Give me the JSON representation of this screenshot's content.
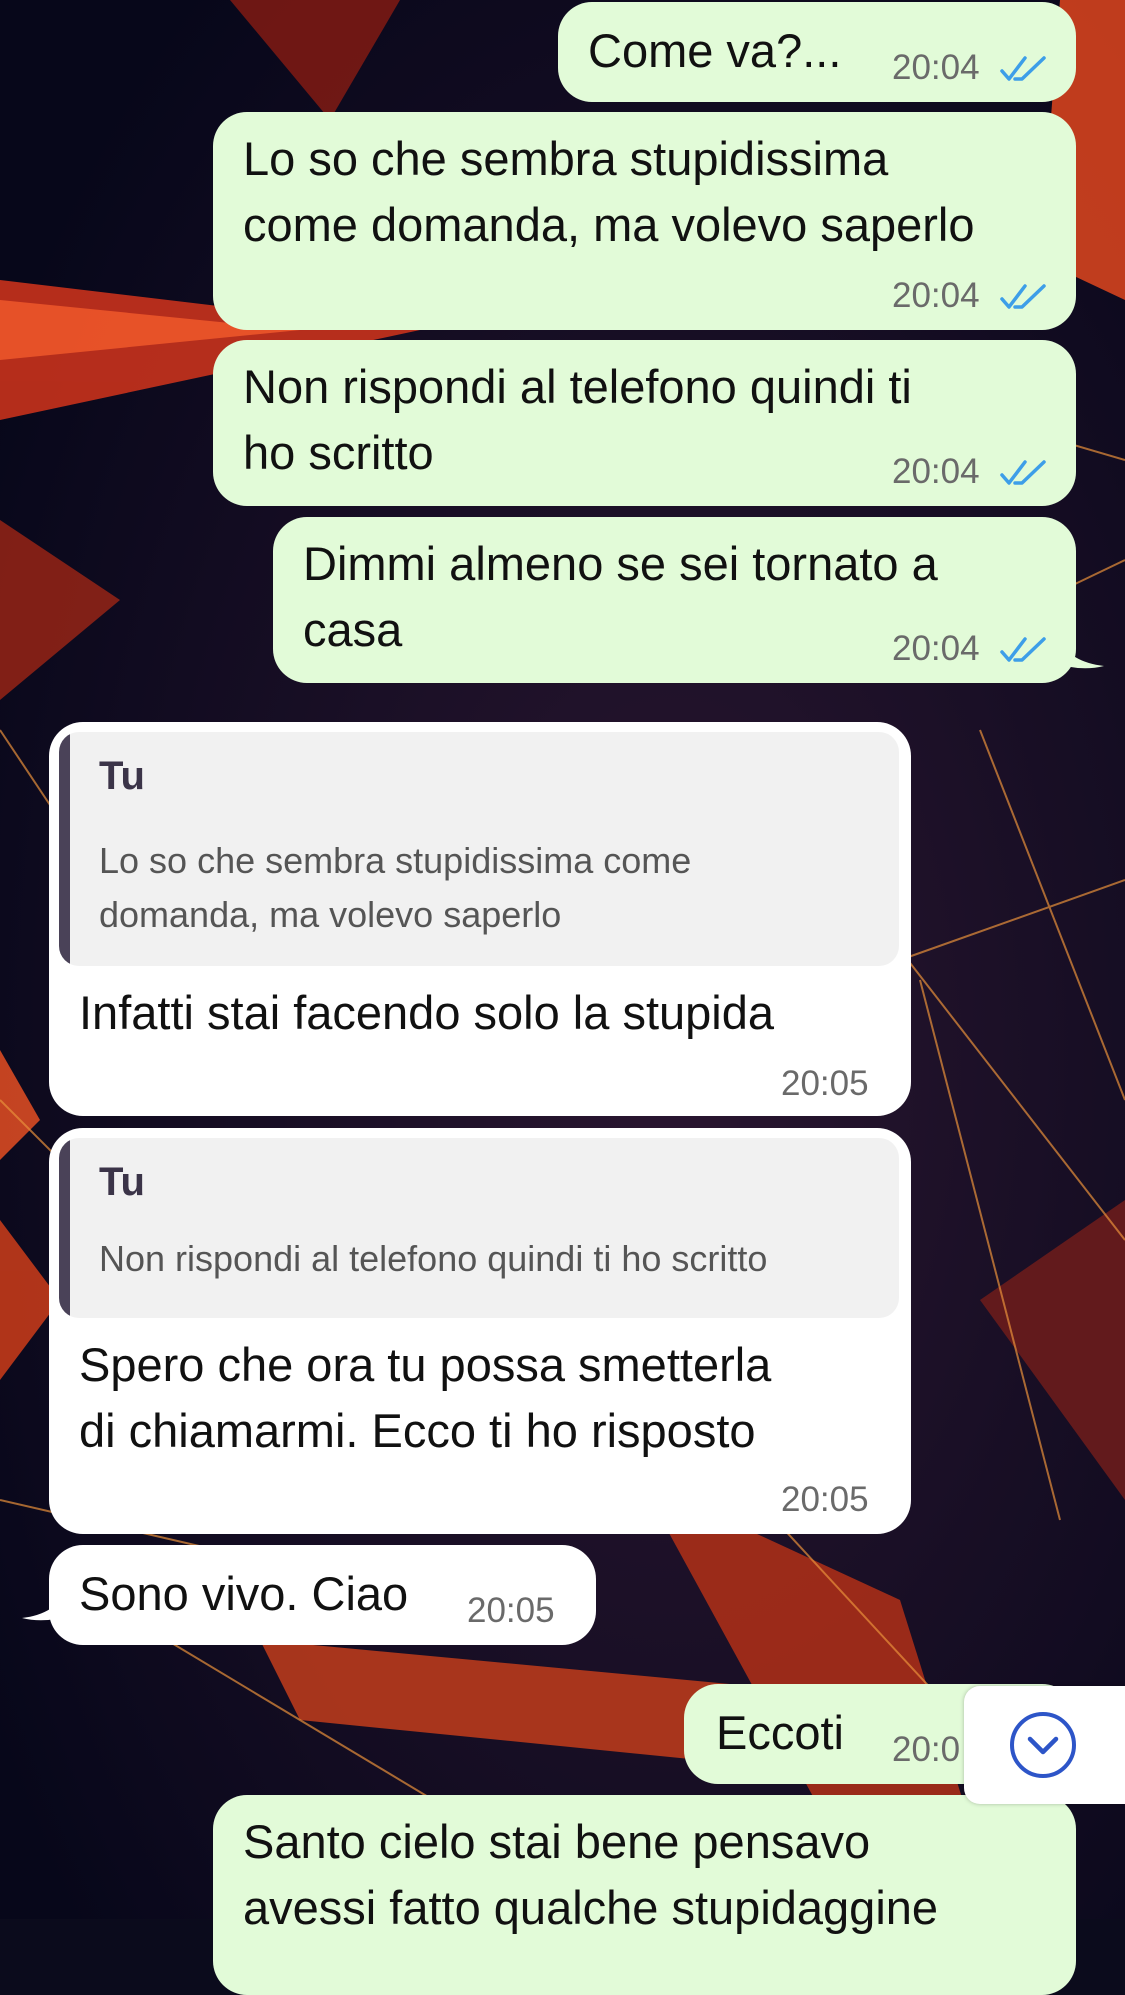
{
  "messages": {
    "m1": {
      "text": "Come va?...",
      "time": "20:04",
      "status": "read"
    },
    "m2": {
      "text": "Lo so che sembra stupidissima\ncome domanda, ma volevo saperlo",
      "time": "20:04",
      "status": "read"
    },
    "m3": {
      "text": "Non rispondi al telefono quindi ti\nho scritto",
      "time": "20:04",
      "status": "read"
    },
    "m4": {
      "text": "Dimmi almeno se sei tornato a\ncasa",
      "time": "20:04",
      "status": "read"
    },
    "m5": {
      "quote": {
        "author": "Tu",
        "text": "Lo so che sembra stupidissima come\ndomanda, ma volevo saperlo"
      },
      "text": "Infatti stai facendo solo la stupida",
      "time": "20:05"
    },
    "m6": {
      "quote": {
        "author": "Tu",
        "text": "Non rispondi al telefono quindi ti ho scritto"
      },
      "text": "Spero che ora tu possa smetterla\ndi chiamarmi. Ecco ti ho risposto",
      "time": "20:05"
    },
    "m7": {
      "text": "Sono vivo. Ciao",
      "time": "20:05"
    },
    "m8": {
      "text": "Eccoti",
      "time": "20:0"
    },
    "m9": {
      "text": "Santo cielo stai bene pensavo\navessi fatto qualche stupidaggine"
    }
  },
  "scroll_button": {
    "icon": "chevron-down-circle-icon"
  },
  "colors": {
    "outgoing_bubble": "#e2fbd8",
    "incoming_bubble": "#ffffff",
    "read_ticks": "#3d9ee8",
    "accent_blue": "#2d55c8",
    "quote_bar": "#4a4258"
  }
}
